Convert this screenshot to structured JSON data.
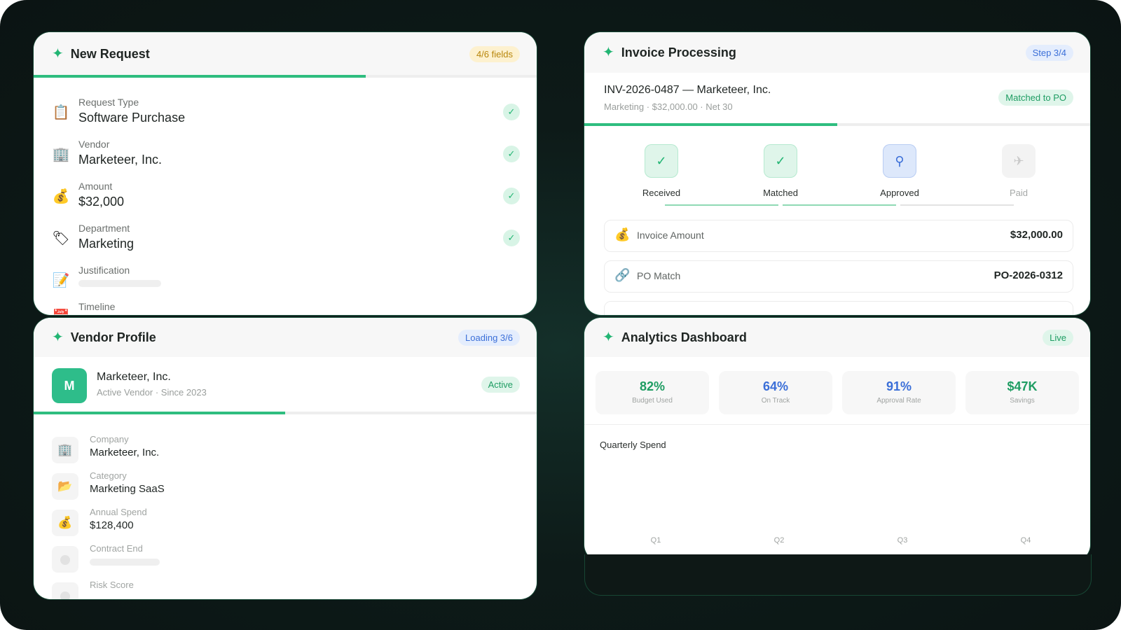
{
  "colors": {
    "accent": "#22b573",
    "progress": "#2ebd7f",
    "approved": "#3b6fd8",
    "amber": "#b8860b"
  },
  "new_request": {
    "title": "New Request",
    "badge": "4/6 fields",
    "progress_fraction": 0.66,
    "fields": [
      {
        "icon": "clipboard-icon",
        "glyph": "📋",
        "label": "Request Type",
        "value": "Software Purchase",
        "done": true
      },
      {
        "icon": "building-icon",
        "glyph": "🏢",
        "label": "Vendor",
        "value": "Marketeer, Inc.",
        "done": true
      },
      {
        "icon": "money-bag-icon",
        "glyph": "💰",
        "label": "Amount",
        "value": "$32,000",
        "done": true
      },
      {
        "icon": "tag-icon",
        "glyph": "🏷",
        "label": "Department",
        "value": "Marketing",
        "done": true
      },
      {
        "icon": "memo-icon",
        "glyph": "📝",
        "label": "Justification",
        "value": "",
        "done": false
      },
      {
        "icon": "calendar-icon",
        "glyph": "📅",
        "label": "Timeline",
        "value": "",
        "done": false
      }
    ],
    "check_glyph": "✓"
  },
  "invoice": {
    "title": "Invoice Processing",
    "badge": "Step 3/4",
    "invoice_title": "INV-2026-0487 — Marketeer, Inc.",
    "invoice_sub": "Marketing · $32,000.00 · Net 30",
    "status_badge": "Matched to PO",
    "progress_fraction": 0.5,
    "steps": [
      {
        "label": "Received",
        "state": "done",
        "glyph": "✓"
      },
      {
        "label": "Matched",
        "state": "done",
        "glyph": "✓"
      },
      {
        "label": "Approved",
        "state": "current",
        "glyph": "⚲"
      },
      {
        "label": "Paid",
        "state": "todo",
        "glyph": "✈"
      }
    ],
    "details": [
      {
        "icon": "money-bag-icon",
        "glyph": "💰",
        "label": "Invoice Amount",
        "value": "$32,000.00"
      },
      {
        "icon": "link-icon",
        "glyph": "🔗",
        "label": "PO Match",
        "value": "PO-2026-0312"
      }
    ]
  },
  "vendor": {
    "title": "Vendor Profile",
    "badge": "Loading 3/6",
    "avatar_letter": "M",
    "name": "Marketeer, Inc.",
    "sub": "Active Vendor · Since 2023",
    "status_badge": "Active",
    "progress_fraction": 0.5,
    "fields": [
      {
        "icon": "building-icon",
        "glyph": "🏢",
        "label": "Company",
        "value": "Marketeer, Inc."
      },
      {
        "icon": "folder-icon",
        "glyph": "📂",
        "label": "Category",
        "value": "Marketing SaaS"
      },
      {
        "icon": "money-bag-icon",
        "glyph": "💰",
        "label": "Annual Spend",
        "value": "$128,400"
      },
      {
        "icon": "loading-dot-icon",
        "glyph": "",
        "label": "Contract End",
        "value": ""
      },
      {
        "icon": "loading-dot-icon",
        "glyph": "",
        "label": "Risk Score",
        "value": ""
      }
    ]
  },
  "analytics": {
    "title": "Analytics Dashboard",
    "badge": "Live",
    "kpis": [
      {
        "value": "82%",
        "label": "Budget Used",
        "color": "#1f9d63"
      },
      {
        "value": "64%",
        "label": "On Track",
        "color": "#3b6fd8"
      },
      {
        "value": "91%",
        "label": "Approval Rate",
        "color": "#3b6fd8"
      },
      {
        "value": "$47K",
        "label": "Savings",
        "color": "#1f9d63"
      }
    ],
    "chart_title": "Quarterly Spend",
    "quarters": [
      "Q1",
      "Q2",
      "Q3",
      "Q4"
    ]
  }
}
